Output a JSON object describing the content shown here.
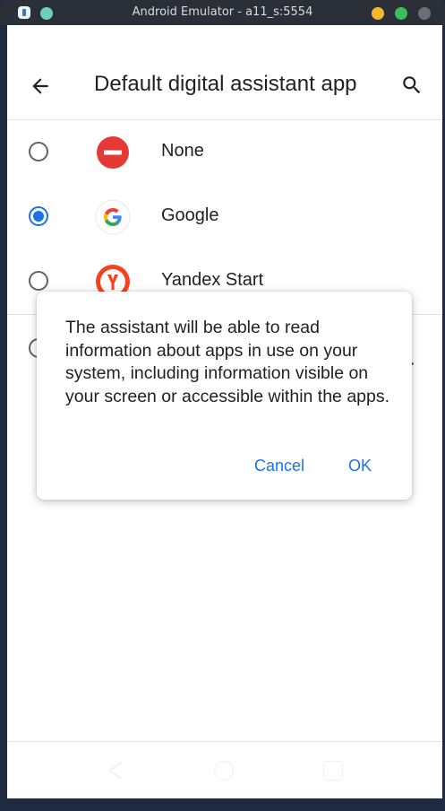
{
  "window": {
    "title": "Android Emulator - a11_s:5554",
    "controls": {
      "minimize_color": "#f5b731",
      "maximize_color": "#3dbe5b",
      "close_color": "#6c6f75",
      "pin_color": "#6ecfc0"
    }
  },
  "appbar": {
    "title": "Default digital assistant app",
    "back_icon": "arrow-back-icon",
    "search_icon": "search-icon"
  },
  "options": [
    {
      "label": "None",
      "selected": false,
      "icon": "none-icon"
    },
    {
      "label": "Google",
      "selected": true,
      "icon": "google-icon"
    },
    {
      "label": "Yandex Start",
      "selected": false,
      "icon": "yandex-icon"
    }
  ],
  "dialog": {
    "message": "The assistant will be able to read information about apps in use on your system, including information visible on your screen or accessible within the apps.",
    "cancel_label": "Cancel",
    "ok_label": "OK"
  },
  "colors": {
    "accent": "#1a73e8",
    "none_red": "#e53935",
    "yandex_red": "#fc3f1d"
  }
}
